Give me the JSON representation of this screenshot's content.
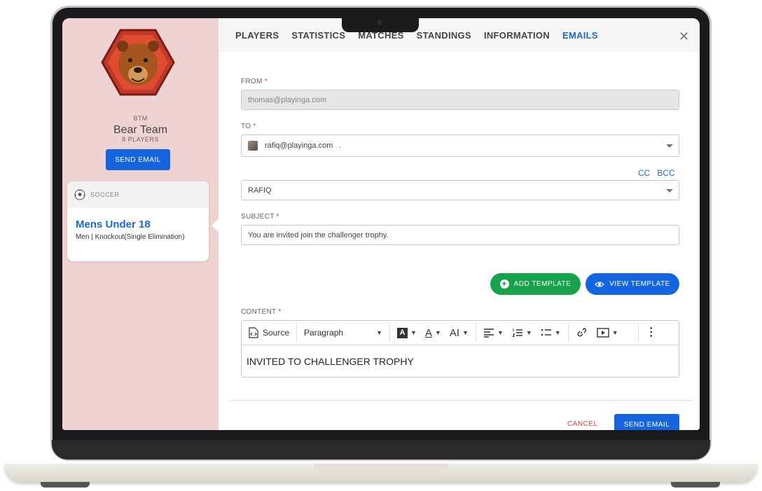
{
  "team": {
    "abbr": "BTM",
    "name": "Bear Team",
    "players": "8 PLAYERS",
    "send_email_label": "SEND EMAIL"
  },
  "competition": {
    "sport": "SOCCER",
    "title": "Mens Under 18",
    "subtitle": "Men | Knockout(Single Elimination)"
  },
  "tabs": [
    {
      "label": "PLAYERS"
    },
    {
      "label": "STATISTICS"
    },
    {
      "label": "MATCHES"
    },
    {
      "label": "STANDINGS"
    },
    {
      "label": "INFORMATION"
    },
    {
      "label": "EMAILS",
      "active": true
    }
  ],
  "form": {
    "from_label": "FROM",
    "from_value": "thomas@playinga.com",
    "to_label": "TO",
    "to_value": "rafiq@playinga.com",
    "to_dot": ".",
    "cc_label": "CC",
    "bcc_label": "BCC",
    "recipient_name": "RAFIQ",
    "subject_label": "SUBJECT",
    "subject_value": "You are invited join the challenger trophy.",
    "add_template_label": "ADD TEMPLATE",
    "view_template_label": "VIEW TEMPLATE",
    "content_label": "CONTENT",
    "required_mark": "*"
  },
  "editor": {
    "source_label": "Source",
    "paragraph_label": "Paragraph",
    "body_text": "INVITED TO CHALLENGER TROPHY"
  },
  "footer": {
    "cancel_label": "CANCEL",
    "send_label": "SEND EMAIL"
  },
  "colors": {
    "accent_blue": "#1565e0",
    "green": "#17a34a",
    "danger": "#e53935",
    "left_panel_bg": "#efd3d3"
  }
}
